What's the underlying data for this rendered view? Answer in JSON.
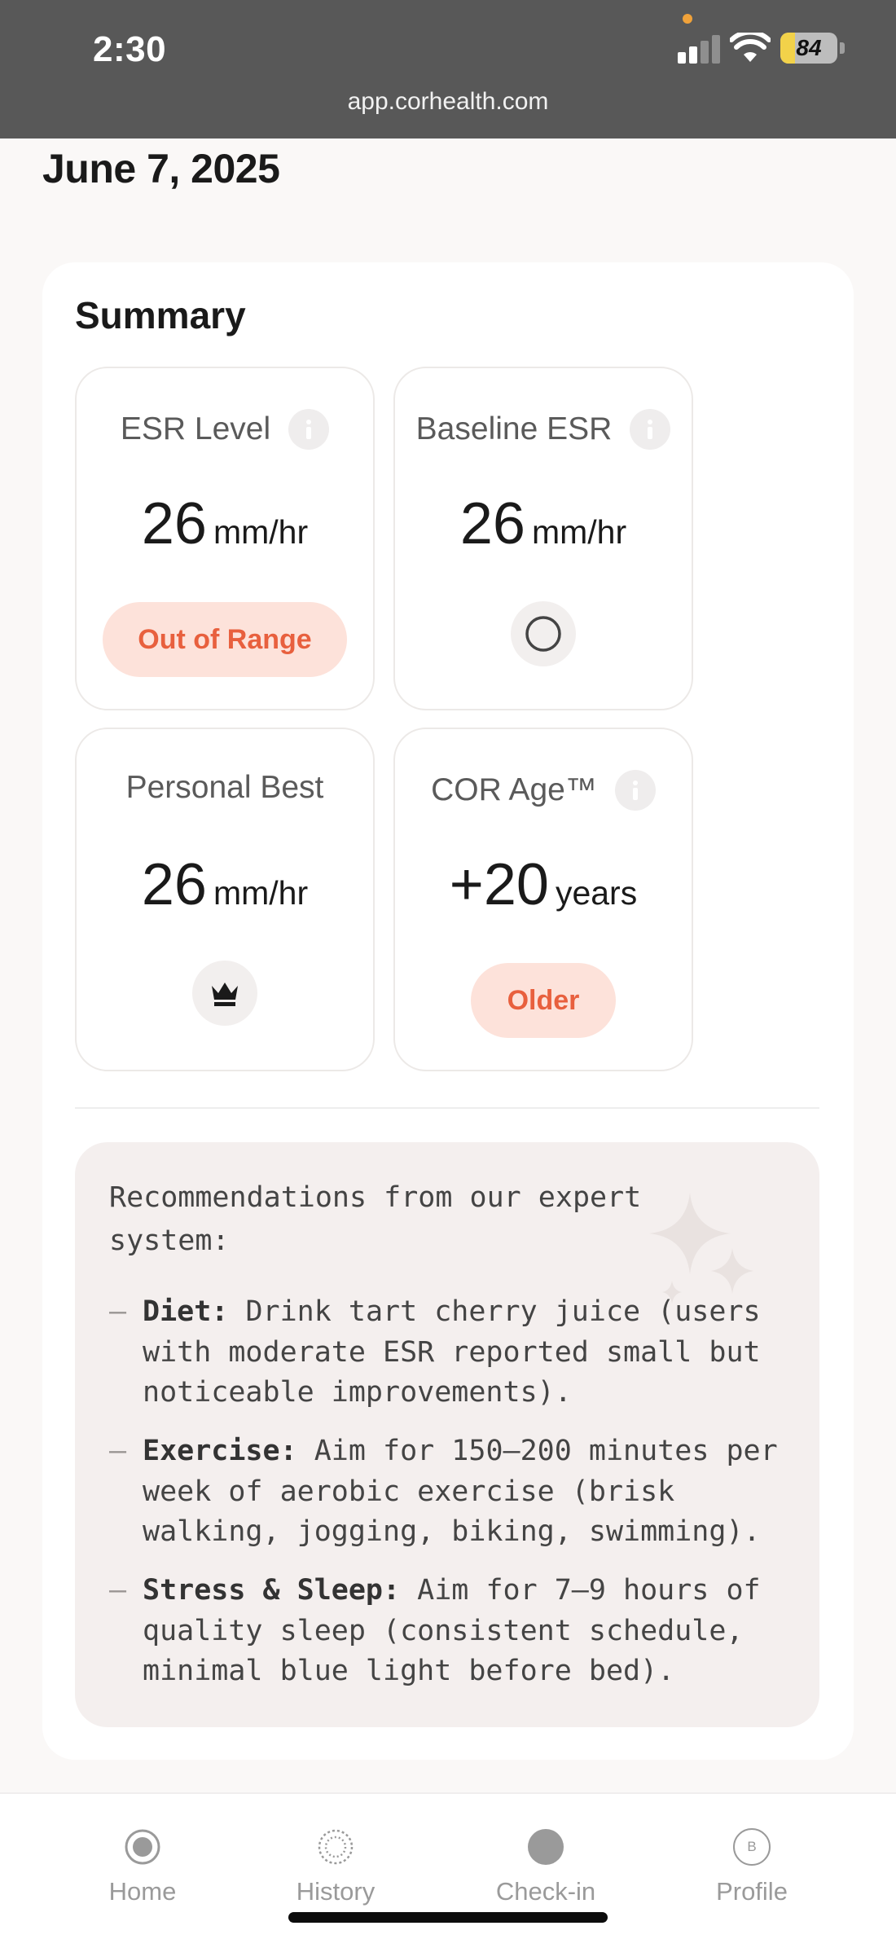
{
  "status_bar": {
    "time": "2:30",
    "url": "app.corhealth.com",
    "battery_label": "84",
    "colors": {
      "background": "#585858",
      "dot": "#f0a23a",
      "battery": "#f2d24a"
    }
  },
  "page": {
    "date": "June 7, 2025"
  },
  "summary": {
    "title": "Summary",
    "esr_level": {
      "title": "ESR Level",
      "value": "26",
      "unit": "mm/hr",
      "status": "Out of Range",
      "icon": "info-icon"
    },
    "baseline_esr": {
      "title": "Baseline ESR",
      "value": "26",
      "unit": "mm/hr",
      "icon": "info-icon",
      "indicator_icon": "empty-circle-icon"
    },
    "personal_best": {
      "title": "Personal Best",
      "value": "26",
      "unit": "mm/hr",
      "indicator_icon": "crown-icon"
    },
    "cor_age": {
      "title": "COR Age™",
      "value": "+20",
      "unit": "years",
      "status": "Older",
      "icon": "info-icon"
    },
    "colors": {
      "pill_bg": "#fde2da",
      "pill_text": "#e8603e"
    }
  },
  "recommendations": {
    "heading": "Recommendations from our expert system:",
    "items": [
      {
        "label": "Diet:",
        "text": "Drink tart cherry juice (users with moderate ESR reported small but noticeable improvements)."
      },
      {
        "label": "Exercise:",
        "text": "Aim for 150–200 minutes per week of aerobic exercise (brisk walking, jogging, biking, swimming)."
      },
      {
        "label": "Stress & Sleep:",
        "text": "Aim for 7–9 hours of quality sleep (consistent schedule, minimal blue light before bed)."
      }
    ],
    "bullet": "–"
  },
  "bottom_nav": {
    "items": [
      {
        "label": "Home",
        "icon": "target-icon"
      },
      {
        "label": "History",
        "icon": "dotted-circle-icon"
      },
      {
        "label": "Check-in",
        "icon": "filled-circle-icon"
      },
      {
        "label": "Profile",
        "icon": "avatar-icon",
        "avatar_initial": "B"
      }
    ]
  }
}
